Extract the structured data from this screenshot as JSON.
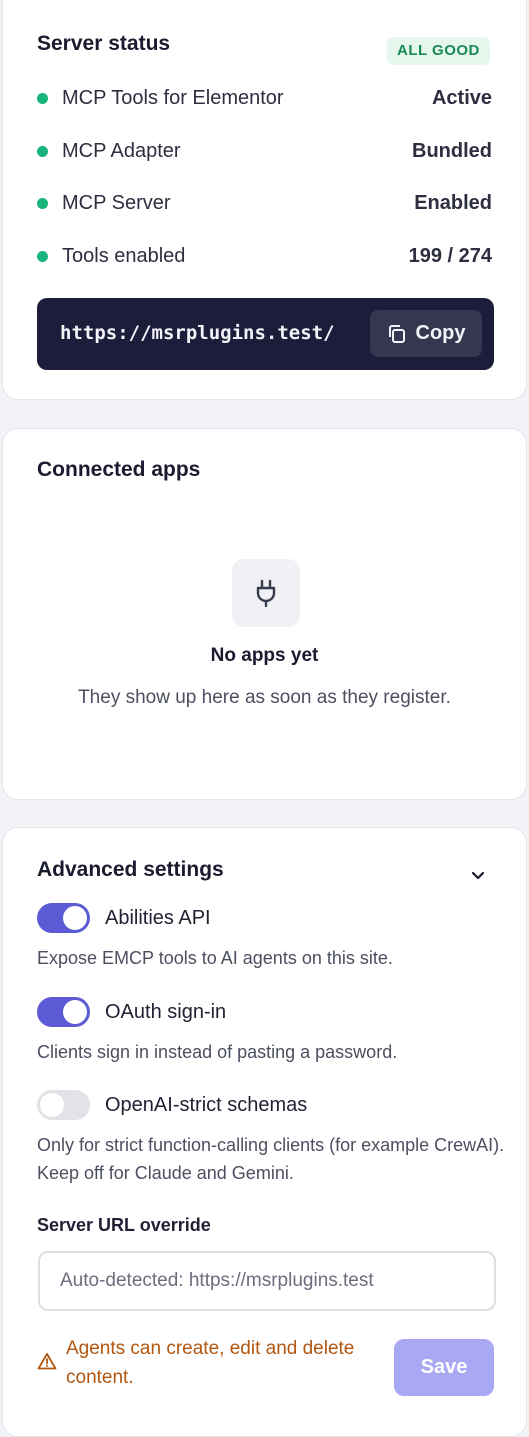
{
  "server_status": {
    "title": "Server status",
    "badge": "ALL GOOD",
    "rows": [
      {
        "label": "MCP Tools for Elementor",
        "value": "Active"
      },
      {
        "label": "MCP Adapter",
        "value": "Bundled"
      },
      {
        "label": "MCP Server",
        "value": "Enabled"
      },
      {
        "label": "Tools enabled",
        "value": "199 / 274"
      }
    ],
    "url": "https://msrplugins.test/",
    "copy_label": "Copy"
  },
  "connected_apps": {
    "title": "Connected apps",
    "empty_icon": "plug-icon",
    "empty_title": "No apps yet",
    "empty_text": "They show up here as soon as they register."
  },
  "advanced": {
    "title": "Advanced settings",
    "toggles": [
      {
        "label": "Abilities API",
        "on": true,
        "description": "Expose EMCP tools to AI agents on this site."
      },
      {
        "label": "OAuth sign-in",
        "on": true,
        "description": "Clients sign in instead of pasting a password."
      },
      {
        "label": "OpenAI-strict schemas",
        "on": false,
        "description": "Only for strict function-calling clients (for example CrewAI). Keep off for Claude and Gemini."
      }
    ],
    "url_override_label": "Server URL override",
    "url_override_placeholder": "Auto-detected: https://msrplugins.test",
    "url_override_value": "",
    "warning": "Agents can create, edit and delete content.",
    "save_label": "Save"
  },
  "colors": {
    "accent": "#5b5bd6",
    "status_ok": "#18b47b",
    "warning": "#b3560f",
    "url_bar_bg": "#1c1c3b"
  }
}
